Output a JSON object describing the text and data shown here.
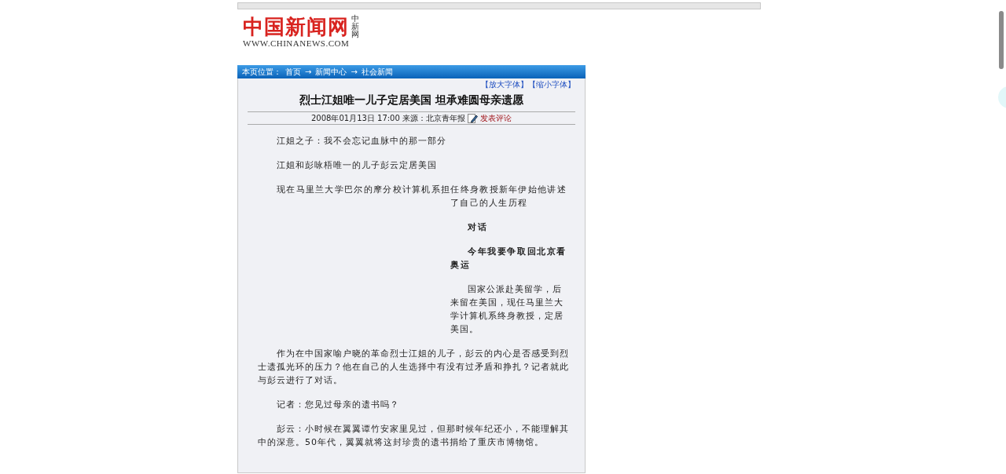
{
  "header": {
    "logo_title": "中国新闻网",
    "logo_subtitle": "中新网",
    "logo_url": "WWW.CHINANEWS.COM"
  },
  "breadcrumb": {
    "label": "本页位置：",
    "separator": "→",
    "items": [
      "首页",
      "新闻中心",
      "社会新闻"
    ]
  },
  "font_controls": [
    "【放大字体】",
    "【缩小字体】"
  ],
  "article": {
    "title": "烈士江姐唯一儿子定居美国 坦承难圆母亲遗愿",
    "dateline": "2008年01月13日 17:00 来源：北京青年报",
    "comment_link": "发表评论",
    "paragraphs": [
      {
        "kind": "plain",
        "text": "江姐之子：我不会忘记血脉中的那一部分"
      },
      {
        "kind": "plain",
        "text": "江姐和彭咏梧唯一的儿子彭云定居美国"
      },
      {
        "kind": "hanging",
        "text": "现在马里兰大学巴尔的摩分校计算机系担任终身教授新年伊始他讲述了自己的人生历程"
      },
      {
        "kind": "side-bold",
        "text": "对话"
      },
      {
        "kind": "side-bold",
        "text": "今年我要争取回北京看奥运"
      },
      {
        "kind": "side",
        "text": "国家公派赴美留学，后来留在美国，现任马里兰大学计算机系终身教授，定居美国。"
      },
      {
        "kind": "body",
        "text": "作为在中国家喻户晓的革命烈士江姐的儿子，彭云的内心是否感受到烈士遗孤光环的压力？他在自己的人生选择中有没有过矛盾和挣扎？记者就此与彭云进行了对话。"
      },
      {
        "kind": "body",
        "text": "记者：您见过母亲的遗书吗？"
      },
      {
        "kind": "body",
        "text": "彭云：小时候在翼翼谭竹安家里见过，但那时候年纪还小，不能理解其中的深意。50年代，翼翼就将这封珍贵的遗书捐给了重庆市博物馆。"
      }
    ]
  }
}
